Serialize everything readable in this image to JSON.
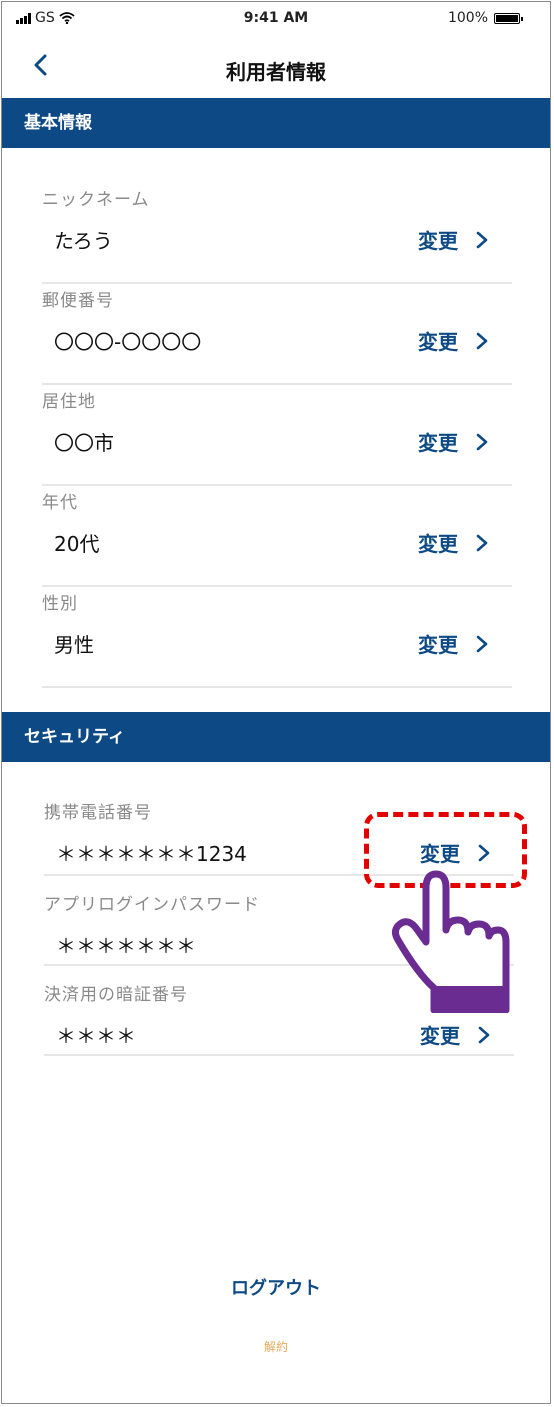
{
  "status": {
    "carrier": "GS",
    "time": "9:41 AM",
    "battery": "100%"
  },
  "nav": {
    "title": "利用者情報"
  },
  "basic": {
    "header": "基本情報",
    "rows": [
      {
        "label": "ニックネーム",
        "value": "たろう",
        "action": "変更"
      },
      {
        "label": "郵便番号",
        "value": "〇〇〇-〇〇〇〇",
        "action": "変更"
      },
      {
        "label": "居住地",
        "value": "〇〇市",
        "action": "変更"
      },
      {
        "label": "年代",
        "value": "20代",
        "action": "変更"
      },
      {
        "label": "性別",
        "value": "男性",
        "action": "変更"
      }
    ]
  },
  "security": {
    "header": "セキュリティ",
    "rows": [
      {
        "label": "携帯電話番号",
        "value": "＊＊＊＊＊＊＊1234",
        "action": "変更"
      },
      {
        "label": "アプリログインパスワード",
        "value": "＊＊＊＊＊＊＊",
        "action": ""
      },
      {
        "label": "決済用の暗証番号",
        "value": "＊＊＊＊",
        "action": "変更"
      }
    ]
  },
  "footer": {
    "logout": "ログアウト",
    "cancel": "解約"
  },
  "colors": {
    "brand": "#0d4a85",
    "highlight": "#e30000",
    "hand": "#6a2c91",
    "cancel": "#e8a95a"
  },
  "icons": {
    "back": "chevron-left-icon",
    "row_action": "chevron-right-icon",
    "pointer": "pointing-hand-icon"
  }
}
